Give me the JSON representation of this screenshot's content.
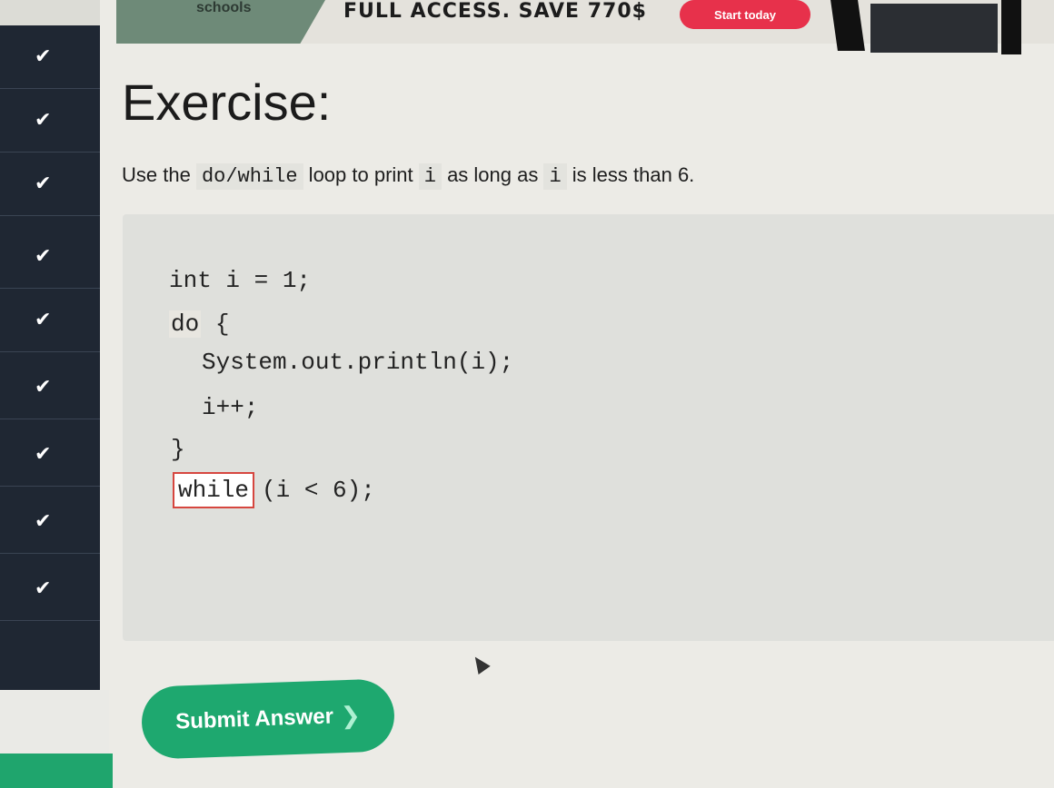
{
  "banner": {
    "schools_label": "schools",
    "promo_text": "FULL ACCESS. SAVE 770$",
    "start_button": "Start today"
  },
  "sidebar": {
    "items": [
      {
        "icon": "check-icon",
        "glyph": "✔"
      },
      {
        "icon": "check-icon",
        "glyph": "✔"
      },
      {
        "icon": "check-icon",
        "glyph": "✔"
      },
      {
        "icon": "check-icon",
        "glyph": "✔"
      },
      {
        "icon": "check-icon",
        "glyph": "✔"
      },
      {
        "icon": "check-icon",
        "glyph": "✔"
      },
      {
        "icon": "check-icon",
        "glyph": "✔"
      },
      {
        "icon": "check-icon",
        "glyph": "✔"
      },
      {
        "icon": "check-icon",
        "glyph": "✔"
      }
    ]
  },
  "exercise": {
    "title": "Exercise:",
    "instruction": {
      "part1": "Use the ",
      "code1": "do/while",
      "part2": " loop to print ",
      "code2": "i",
      "part3": " as long as ",
      "code3": "i",
      "part4": " is less than 6."
    },
    "code": {
      "line1": "int i = 1;",
      "line2_kw": "do",
      "line2_rest": " {",
      "line3": "System.out.println(i);",
      "line4": "i++;",
      "line5": "}",
      "answer_value": "while",
      "line6_rest": "(i < 6);"
    },
    "submit_label": "Submit Answer",
    "submit_icon": "❯"
  },
  "colors": {
    "accent_green": "#1ea86f",
    "start_red": "#e7314b",
    "sidebar_bg": "#1f2733"
  }
}
